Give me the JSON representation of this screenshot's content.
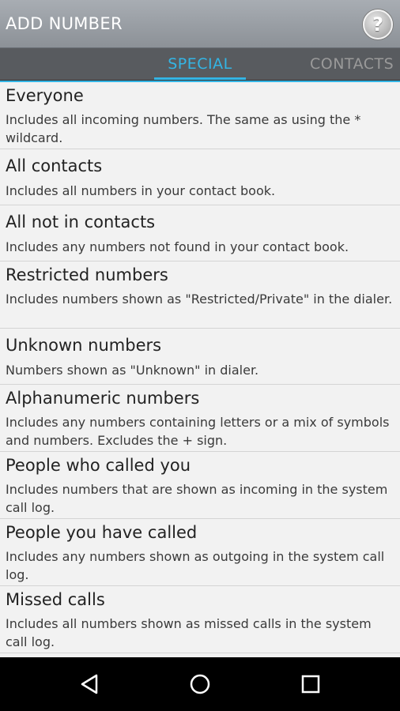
{
  "header": {
    "title": "ADD NUMBER",
    "help_icon": "help-question-icon"
  },
  "tabs": [
    {
      "label": "SPECIAL",
      "selected": true
    },
    {
      "label": "CONTACTS",
      "selected": false
    }
  ],
  "colors": {
    "accent": "#33b5e5",
    "titlebar": "#9a9fa5",
    "tabbar": "#585b5f",
    "background": "#f2f2f2"
  },
  "items": [
    {
      "title": "Everyone",
      "desc": "Includes all incoming numbers. The same as using the * wildcard."
    },
    {
      "title": "All contacts",
      "desc": "Includes all numbers in your contact book."
    },
    {
      "title": "All not in contacts",
      "desc": "Includes any numbers not found in your contact book."
    },
    {
      "title": "Restricted numbers",
      "desc": "Includes numbers shown as \"Restricted/Private\" in the dialer."
    },
    {
      "title": "Unknown numbers",
      "desc": "Numbers shown as \"Unknown\" in dialer."
    },
    {
      "title": "Alphanumeric numbers",
      "desc": "Includes any numbers containing letters or a mix of symbols and numbers. Excludes the + sign."
    },
    {
      "title": "People who called you",
      "desc": "Includes numbers that are shown as incoming in the system call log."
    },
    {
      "title": "People you have called",
      "desc": "Includes any numbers shown as outgoing in the system call log."
    },
    {
      "title": "Missed calls",
      "desc": "Includes all numbers shown as missed calls in the system call log."
    }
  ],
  "navbar": {
    "back_icon": "back-icon",
    "home_icon": "home-icon",
    "recents_icon": "recent-apps-icon"
  }
}
